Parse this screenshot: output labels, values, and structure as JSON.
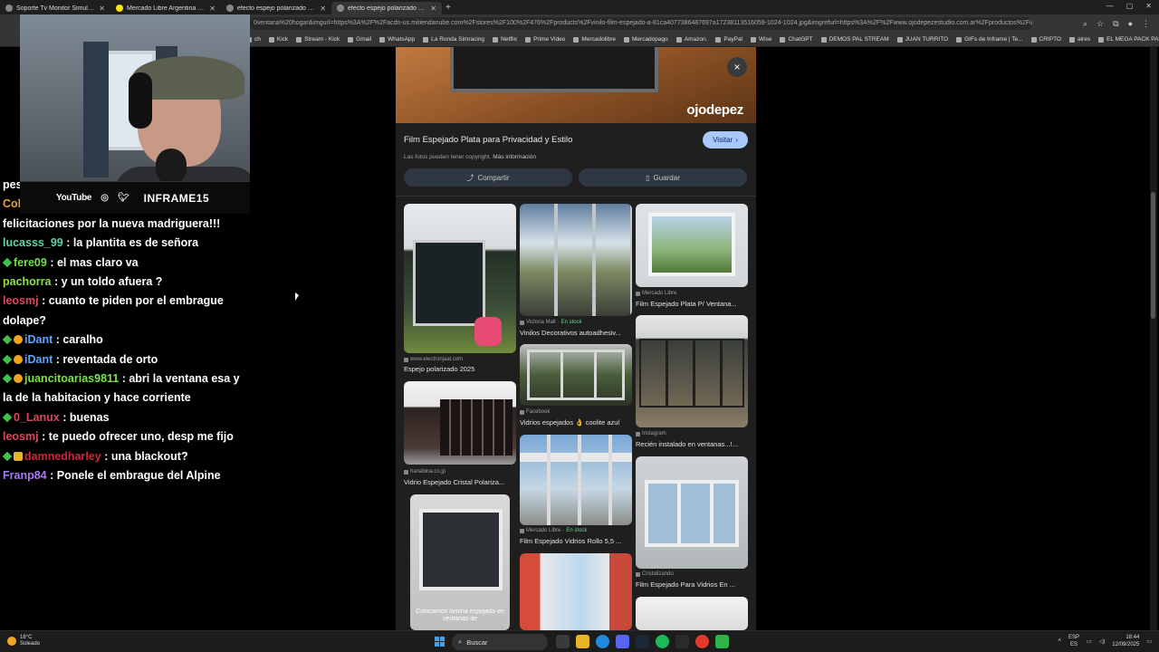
{
  "browser": {
    "tabs": [
      {
        "label": "Soporte Tv Monitor Simulador De",
        "fav": "gear"
      },
      {
        "label": "Mercado Libre Argentina - Envío",
        "fav": "ml"
      },
      {
        "label": "efecto espejo polarizado ventan",
        "fav": "google"
      },
      {
        "label": "efecto espejo polarizado ventan",
        "fav": "google"
      }
    ],
    "new_tab": "+",
    "url": "0ventana%20hogar&imgurl=https%3A%2F%2Facdn-us.mitiendanube.com%2Fstores%2F100%2F476%2Fproducts%2Fvinilo-film-espejado-a-81ca4077386487697a17238113516059-1024-1024.jpg&imgrefurl=https%3A%2F%2Fwww.ojodepezestudio.com.ar%2Fproductos%2Film-e...",
    "bookmarks": [
      "ch",
      "Kick",
      "Stream - Kick",
      "Gmail",
      "WhatsApp",
      "La Ronda Simracing",
      "Netflix",
      "Prime Video",
      "Mercadolibre",
      "Mercadopago",
      "Amazon.",
      "PayPal",
      "Wise",
      "ChatGPT",
      "DEMOS PAL STREAM",
      "JUAN TURRITO",
      "GIFs de Inframe | Te...",
      "CRIPTO",
      "aires",
      "EL MEGA PACK PAP..."
    ]
  },
  "overlay": {
    "youtube": "YouTube",
    "handle": "INFRAME15"
  },
  "chat": [
    {
      "user": "pes",
      "msg": "",
      "color": "#ffffff",
      "badges": []
    },
    {
      "user": "Col",
      "msg": "",
      "color": "#e8a13a",
      "badges": []
    },
    {
      "user": "",
      "msg": "felicitaciones por la nueva madriguera!!!",
      "color": "#ffffff",
      "badges": []
    },
    {
      "user": "lucasss_99",
      "msg": " : la plantita es de señora",
      "color": "#5fd3a4",
      "badges": []
    },
    {
      "user": "fere09",
      "msg": " : el mas claro va",
      "color": "#6fe04c",
      "badges": [
        "diamond"
      ]
    },
    {
      "user": "pachorra",
      "msg": " : y un toldo afuera ?",
      "color": "#8be04e",
      "badges": []
    },
    {
      "user": "leosmj",
      "msg": " : cuanto te piden por el embrague dolape?",
      "color": "#e0455a",
      "badges": []
    },
    {
      "user": "iDant",
      "msg": " : caralho",
      "color": "#5ea5ff",
      "badges": [
        "diamond",
        "coin"
      ]
    },
    {
      "user": "iDant",
      "msg": " : reventada de orto",
      "color": "#5ea5ff",
      "badges": [
        "diamond",
        "coin"
      ]
    },
    {
      "user": "juancitoarias9811",
      "msg": " : abri la ventana esa y la de la habitacion y hace corriente",
      "color": "#7be04c",
      "badges": [
        "diamond",
        "coin"
      ]
    },
    {
      "user": "0_Lanux",
      "msg": " : buenas",
      "color": "#e0455a",
      "badges": [
        "diamond"
      ]
    },
    {
      "user": "leosmj",
      "msg": " : te puedo ofrecer uno, desp me fijo",
      "color": "#e0455a",
      "badges": []
    },
    {
      "user": "damnedharley",
      "msg": " : una blackout?",
      "color": "#d0243a",
      "badges": [
        "diamond",
        "crown"
      ]
    },
    {
      "user": "Franp84",
      "msg": " : Ponele el embrague del Alpine",
      "color": "#a978f0",
      "badges": []
    }
  ],
  "panel": {
    "hero_brand": "ojodepez",
    "close": "×",
    "title": "Film Espejado Plata para Privacidad y Estilo",
    "visit": "Visitar",
    "copyright": "Las fotos pueden tener copyright.",
    "more_info": "Más información",
    "share": "Compartir",
    "save": "Guardar",
    "results": [
      {
        "src": "www.electronjaal.com",
        "stock": "",
        "title": "Espejo polarizado 2025"
      },
      {
        "src": "hanabina.co.jp",
        "stock": "",
        "title": "Vidrio Espejado Cristal Polariza..."
      },
      {
        "src": "Victoria Mall",
        "stock": "En stock",
        "title": "Vinilos Decorativos autoadhesiv..."
      },
      {
        "src": "Facebook",
        "stock": "",
        "title": "Vidrios espejados 👌 coolite azul"
      },
      {
        "src": "Mercado Libre",
        "stock": "En stock",
        "title": "Film Espejado Vidrios Rollo 5,5 ..."
      },
      {
        "src": "Mercado Libre",
        "stock": "",
        "title": "Film Espejado Plata P/ Ventana..."
      },
      {
        "src": "Instagram",
        "stock": "",
        "title": "Recién instalado en ventanas...!..."
      },
      {
        "src": "Cristalizando",
        "stock": "",
        "title": "Film Espejado Para Vidrios En ..."
      }
    ],
    "thumb_caption": "Colocamos lamina espejada en ventanas de"
  },
  "taskbar": {
    "temp": "18°C",
    "weather": "Soleado",
    "search": "Buscar",
    "lang1": "ESP",
    "lang2": "ES",
    "time": "18:44",
    "date": "12/09/2025"
  }
}
